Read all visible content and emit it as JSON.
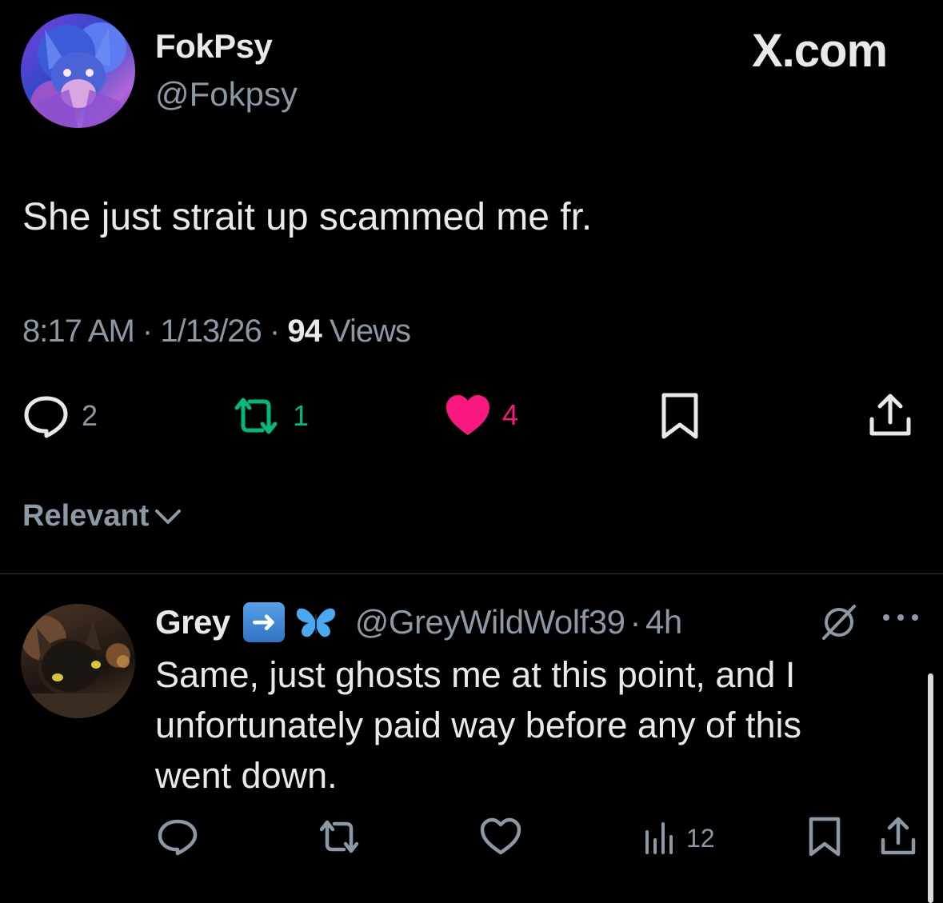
{
  "tweet": {
    "display_name": "FokPsy",
    "handle": "@Fokpsy",
    "brand": "X.com",
    "text": "She just strait up scammed me fr.",
    "time": "8:17 AM",
    "date": "1/13/26",
    "views_count": "94",
    "views_label": "Views",
    "stats": {
      "replies": "2",
      "reposts": "1",
      "likes": "4"
    }
  },
  "sort": {
    "label": "Relevant"
  },
  "reply": {
    "display_name": "Grey",
    "handle": "@GreyWildWolf39",
    "age": "4h",
    "text_lines": [
      "Same, just ghosts me at this point, and I",
      "unfortunately paid way before any of this",
      "went down."
    ],
    "views": "12"
  },
  "colors": {
    "background": "#000000",
    "primary_text": "#e7e9ea",
    "secondary_text": "#8b98a5",
    "repost_green": "#00ba7c",
    "like_pink": "#f91880",
    "divider": "#2f3336"
  },
  "icons": {
    "reply": "speech-bubble-icon",
    "repost": "repost-arrows-icon",
    "like": "heart-icon",
    "bookmark": "bookmark-icon",
    "share": "share-upload-icon",
    "views": "bar-chart-icon",
    "grok": "slash-circle-icon",
    "more": "ellipsis-icon",
    "sort": "chevron-down-icon"
  }
}
